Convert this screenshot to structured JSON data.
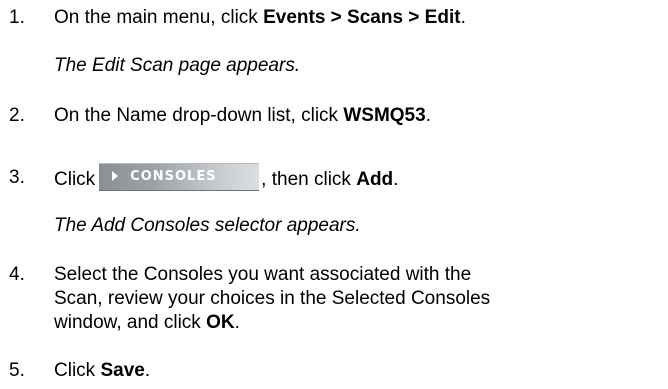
{
  "steps": [
    {
      "number": "1.",
      "prefix": "On the main menu, click ",
      "bold": "Events > Scans > Edit",
      "suffix": ".",
      "result": "The Edit Scan page appears."
    },
    {
      "number": "2.",
      "prefix": "On the Name drop-down list, click ",
      "bold": "WSMQ53",
      "suffix": "."
    },
    {
      "number": "3.",
      "prefix": "Click",
      "button_label": "CONSOLES",
      "middle": ", then click ",
      "bold": "Add",
      "suffix": ".",
      "result": "The Add Consoles selector appears."
    },
    {
      "number": "4.",
      "line1": "Select the Consoles you want associated with the",
      "line2": "Scan, review your choices in the Selected Consoles",
      "line3_prefix": "window, and click ",
      "bold": "OK",
      "suffix": "."
    },
    {
      "number": "5.",
      "prefix": "Click ",
      "bold": "Save",
      "suffix": "."
    }
  ]
}
